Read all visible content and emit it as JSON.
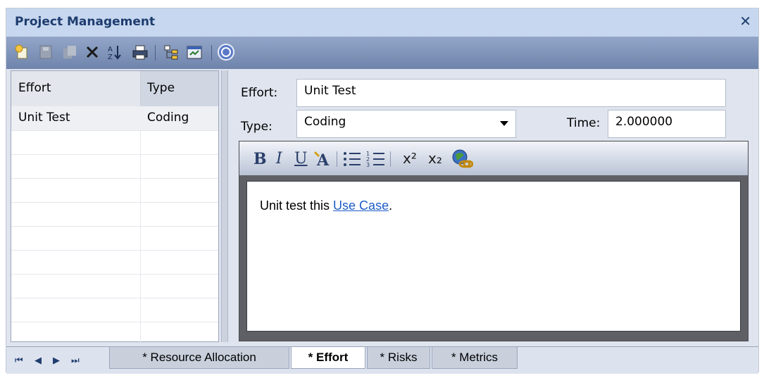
{
  "window": {
    "title": "Project Management",
    "close_glyph": "✕"
  },
  "toolbar": {
    "icons": [
      "new-item-icon",
      "save-icon",
      "copy-icon",
      "delete-icon",
      "sort-icon",
      "print-icon",
      "tree-icon",
      "properties-icon",
      "help-icon"
    ]
  },
  "list": {
    "headers": {
      "effort": "Effort",
      "type": "Type"
    },
    "rows": [
      {
        "effort": "Unit Test",
        "type": "Coding"
      }
    ]
  },
  "form": {
    "effort_label": "Effort:",
    "effort_value": "Unit Test",
    "type_label": "Type:",
    "type_value": "Coding",
    "time_label": "Time:",
    "time_value": "2.000000"
  },
  "editor": {
    "toolbar": {
      "bold": "B",
      "italic": "I",
      "underline": "U",
      "superscript": "x²",
      "subscript": "x₂"
    },
    "text_before": "Unit test this ",
    "link_text": "Use Case",
    "text_after": "."
  },
  "tabs": {
    "nav": [
      "⏮",
      "◀",
      "▶",
      "⏭"
    ],
    "items": [
      {
        "label": "* Resource Allocation",
        "active": false
      },
      {
        "label": "* Effort",
        "active": true
      },
      {
        "label": "* Risks",
        "active": false
      },
      {
        "label": "* Metrics",
        "active": false
      }
    ]
  },
  "colors": {
    "title_bg": "#c7d7ef",
    "toolbar_bg": "#7b8fb5",
    "link": "#1d5cc7"
  }
}
